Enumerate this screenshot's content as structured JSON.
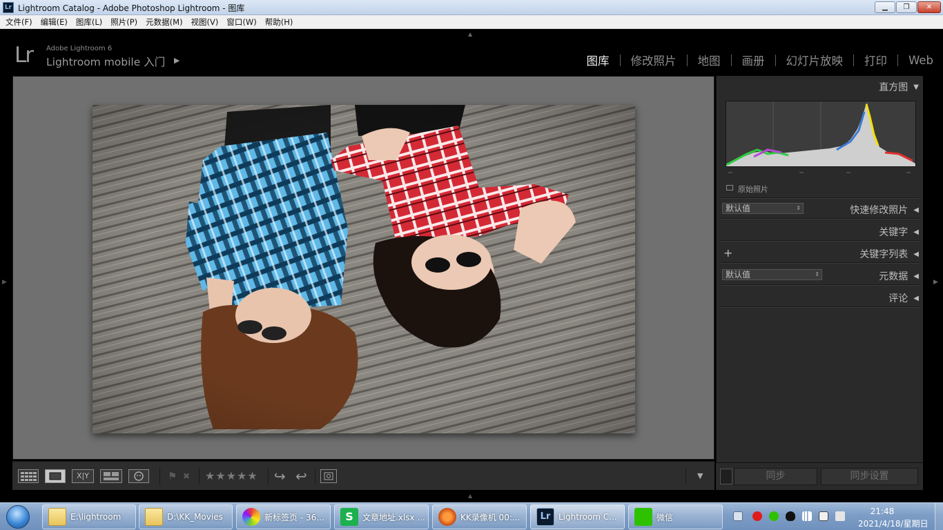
{
  "window": {
    "title": "Lightroom Catalog - Adobe Photoshop Lightroom - 图库",
    "app_icon": "Lr",
    "min_glyph": "▁",
    "max_glyph": "❐",
    "close_glyph": "✕"
  },
  "menu": [
    "文件(F)",
    "编辑(E)",
    "图库(L)",
    "照片(P)",
    "元数据(M)",
    "视图(V)",
    "窗口(W)",
    "帮助(H)"
  ],
  "identity": {
    "logo": "Lr",
    "product": "Adobe Lightroom 6",
    "mobile_label": "Lightroom mobile 入门",
    "play_glyph": "▶"
  },
  "modules": [
    "图库",
    "修改照片",
    "地图",
    "画册",
    "幻灯片放映",
    "打印",
    "Web"
  ],
  "active_module": "图库",
  "toolbar": {
    "compare_label": "X|Y",
    "stars": "★★★★★",
    "rotate_left_glyph": "↪",
    "rotate_right_glyph": "↩",
    "menu_glyph": "▼",
    "flag_glyph": "⚑",
    "reject_glyph": "✖"
  },
  "right_panel": {
    "histogram_title": "直方图",
    "original_photo_label": "原始照片",
    "quick_develop": {
      "title": "快速修改照片",
      "preset": "默认值"
    },
    "keywording": {
      "title": "关键字"
    },
    "keyword_list": {
      "title": "关键字列表",
      "add_glyph": "+"
    },
    "metadata": {
      "title": "元数据",
      "preset": "默认值"
    },
    "comments": {
      "title": "评论"
    },
    "sync_button": "同步",
    "sync_settings_button": "同步设置",
    "collapse_glyph": "◀",
    "expand_glyph": "▼",
    "spinner_glyph": "⇕"
  },
  "taskbar": {
    "items": [
      {
        "label": "E:\\lightroom",
        "icon": "folder-icon"
      },
      {
        "label": "D:\\KK_Movies",
        "icon": "folder-icon"
      },
      {
        "label": "新标签页 - 36...",
        "icon": "browser-icon"
      },
      {
        "label": "文章地址.xlsx ...",
        "icon": "wps-spreadsheet-icon"
      },
      {
        "label": "KK录像机 00:...",
        "icon": "kk-recorder-icon"
      },
      {
        "label": "Lightroom C...",
        "icon": "lightroom-icon"
      },
      {
        "label": "微信",
        "icon": "wechat-icon"
      }
    ],
    "wps_glyph": "S",
    "lr_glyph": "Lr",
    "clock_time": "21:48",
    "clock_date": "2021/4/18/星期日"
  }
}
